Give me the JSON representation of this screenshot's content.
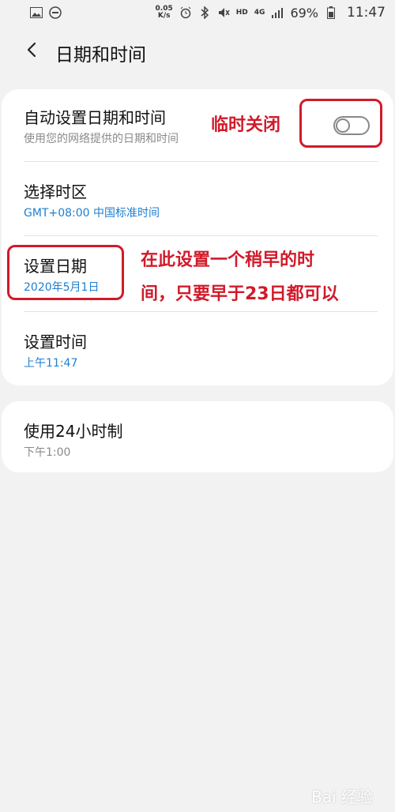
{
  "status_bar": {
    "speed_value": "0.05",
    "speed_unit": "K/s",
    "hd_label": "HD",
    "network_label": "4G",
    "battery": "69%",
    "time": "11:47"
  },
  "header": {
    "title": "日期和时间"
  },
  "settings": {
    "auto_datetime": {
      "title": "自动设置日期和时间",
      "subtitle": "使用您的网络提供的日期和时间",
      "enabled": false
    },
    "timezone": {
      "title": "选择时区",
      "value": "GMT+08:00 中国标准时间"
    },
    "set_date": {
      "title": "设置日期",
      "value": "2020年5月1日"
    },
    "set_time": {
      "title": "设置时间",
      "value": "上午11:47"
    },
    "format_24h": {
      "title": "使用24小时制",
      "value": "下午1:00"
    }
  },
  "annotations": {
    "toggle_note": "临时关闭",
    "date_note_line1": "在此设置一个稍早的时",
    "date_note_line2": "间，只要早于23日都可以",
    "color": "#d11a2a"
  },
  "watermark": {
    "text": "Bai 经验"
  },
  "colors": {
    "background": "#f2f2f2",
    "card": "#ffffff",
    "accent_blue": "#1e7fd0",
    "annotation_red": "#d11a2a"
  }
}
